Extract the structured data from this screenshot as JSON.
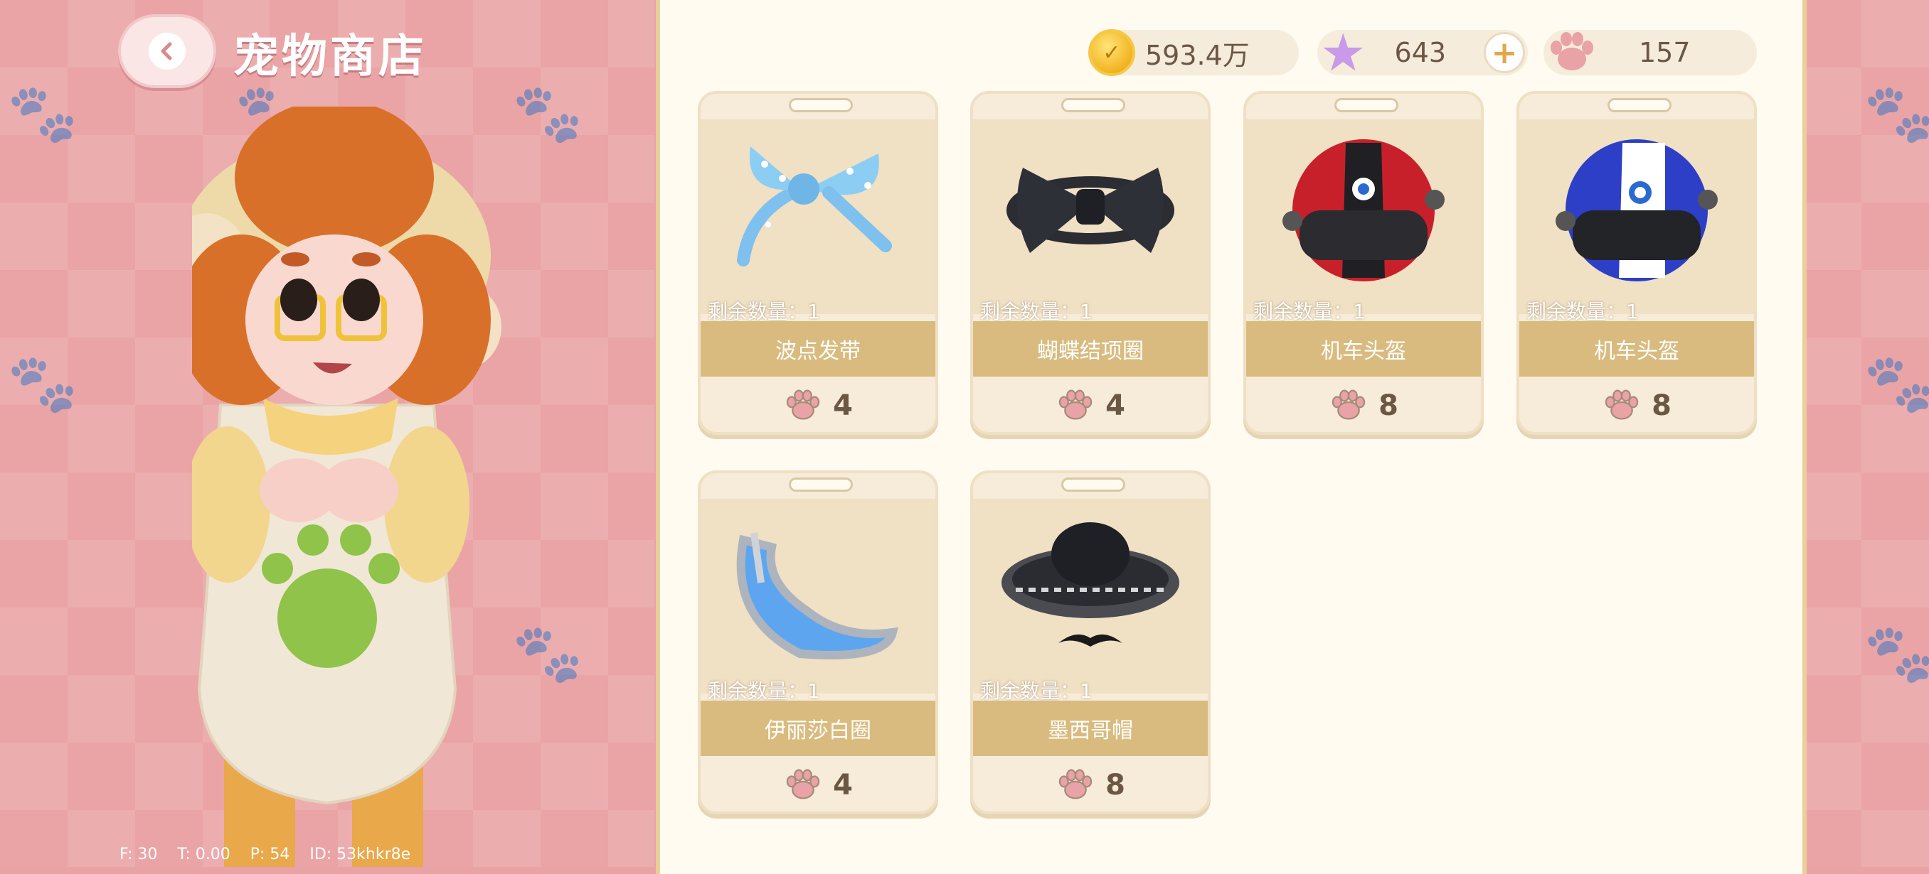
{
  "header": {
    "title": "宠物商店",
    "back_icon": "chevron-left-icon"
  },
  "currencies": {
    "coins": {
      "value": "593.4万",
      "icon": "coin-icon"
    },
    "stars": {
      "value": "643",
      "icon": "star-icon",
      "add_label": "+"
    },
    "paws": {
      "value": "157",
      "icon": "paw-icon"
    }
  },
  "items": [
    {
      "name": "波点发带",
      "remaining": "剩余数量：1",
      "price": "4"
    },
    {
      "name": "蝴蝶结项圈",
      "remaining": "剩余数量：1",
      "price": "4"
    },
    {
      "name": "机车头盔",
      "remaining": "剩余数量：1",
      "price": "8"
    },
    {
      "name": "机车头盔",
      "remaining": "剩余数量：1",
      "price": "8"
    },
    {
      "name": "伊丽莎白圈",
      "remaining": "剩余数量：1",
      "price": "4"
    },
    {
      "name": "墨西哥帽",
      "remaining": "剩余数量：1",
      "price": "8"
    }
  ],
  "debug": "F: 30    T: 0.00    P: 54    ID: 53khkr8e",
  "colors": {
    "panel_bg": "#fffbf1",
    "name_bar": "#d9bb7f",
    "page_bg": "#eaa4a6"
  }
}
